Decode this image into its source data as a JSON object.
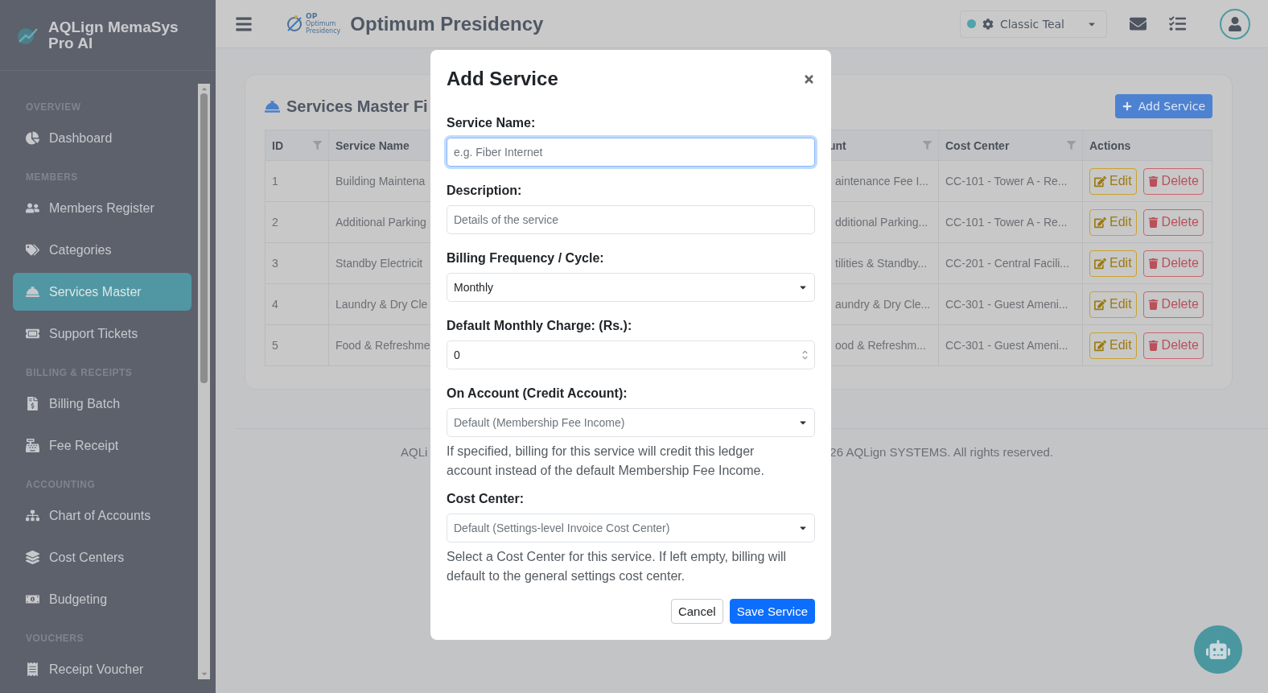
{
  "brand": {
    "name": "AQLign MemaSys Pro AI"
  },
  "sidebar": {
    "sections": [
      {
        "heading": "OVERVIEW",
        "items": [
          {
            "label": "Dashboard",
            "selected": false
          }
        ]
      },
      {
        "heading": "MEMBERS",
        "items": [
          {
            "label": "Members Register",
            "selected": false
          },
          {
            "label": "Categories",
            "selected": false
          },
          {
            "label": "Services Master",
            "selected": true
          },
          {
            "label": "Support Tickets",
            "selected": false
          }
        ]
      },
      {
        "heading": "BILLING & RECEIPTS",
        "items": [
          {
            "label": "Billing Batch",
            "selected": false
          },
          {
            "label": "Fee Receipt",
            "selected": false
          }
        ]
      },
      {
        "heading": "ACCOUNTING",
        "items": [
          {
            "label": "Chart of Accounts",
            "selected": false
          },
          {
            "label": "Cost Centers",
            "selected": false
          },
          {
            "label": "Budgeting",
            "selected": false
          }
        ]
      },
      {
        "heading": "VOUCHERS",
        "items": [
          {
            "label": "Receipt Voucher",
            "selected": false
          }
        ]
      }
    ]
  },
  "header": {
    "logo": {
      "mark": "OP",
      "caption": "Optimum",
      "subcaption": "Presidency"
    },
    "title": "Optimum Presidency",
    "theme": {
      "label": "Classic Teal",
      "color": "#4fa3ab"
    }
  },
  "card": {
    "title": "Services Master Fi",
    "add_button": "Add Service",
    "table": {
      "columns": [
        {
          "label": "ID",
          "filter": true
        },
        {
          "label": "Service Name"
        },
        {
          "label": "unt",
          "filter": true
        },
        {
          "label": "Cost Center",
          "filter": true
        },
        {
          "label": "Actions",
          "filter": false
        }
      ],
      "rows": [
        {
          "id": "1",
          "name": "Building Maintena",
          "account": "aintenance Fee I...",
          "cost_center": "CC-101 - Tower A - Re...",
          "edit": "Edit",
          "delete": "Delete"
        },
        {
          "id": "2",
          "name": "Additional Parking",
          "account": "dditional Parking...",
          "cost_center": "CC-101 - Tower A - Re...",
          "edit": "Edit",
          "delete": "Delete"
        },
        {
          "id": "3",
          "name": "Standby Electricit",
          "account": "tilities & Standby...",
          "cost_center": "CC-201 - Central Facili...",
          "edit": "Edit",
          "delete": "Delete"
        },
        {
          "id": "4",
          "name": "Laundry & Dry Cle",
          "account": "aundry & Dry Cle...",
          "cost_center": "CC-301 - Guest Ameni...",
          "edit": "Edit",
          "delete": "Delete"
        },
        {
          "id": "5",
          "name": "Food & Refreshme",
          "account": "ood & Refreshm...",
          "cost_center": "CC-301 - Guest Ameni...",
          "edit": "Edit",
          "delete": "Delete"
        }
      ]
    }
  },
  "footer": {
    "left": "AQLi",
    "right": "26 AQLign SYSTEMS. All rights reserved."
  },
  "modal": {
    "title": "Add Service",
    "fields": [
      {
        "kind": "text",
        "label": "Service Name:",
        "placeholder": "e.g. Fiber Internet",
        "focused": true
      },
      {
        "kind": "text",
        "label": "Description:",
        "placeholder": "Details of the service",
        "focused": false
      },
      {
        "kind": "select",
        "label": "Billing Frequency / Cycle:",
        "value": "Monthly",
        "focused": false
      },
      {
        "kind": "number",
        "label": "Default Monthly Charge: (Rs.):",
        "value": "0",
        "focused": false
      },
      {
        "kind": "select",
        "label": "On Account (Credit Account):",
        "placeholder": "Default (Membership Fee Income)",
        "help": "If specified, billing for this service will credit this ledger account instead of the default Membership Fee Income.",
        "focused": false
      },
      {
        "kind": "select",
        "label": "Cost Center:",
        "placeholder": "Default (Settings-level Invoice Cost Center)",
        "help": "Select a Cost Center for this service. If left empty, billing will default to the general settings cost center.",
        "focused": false
      }
    ],
    "buttons": [
      {
        "kind": "secondary",
        "label": "Cancel"
      },
      {
        "kind": "primary",
        "label": "Save Service"
      }
    ]
  }
}
